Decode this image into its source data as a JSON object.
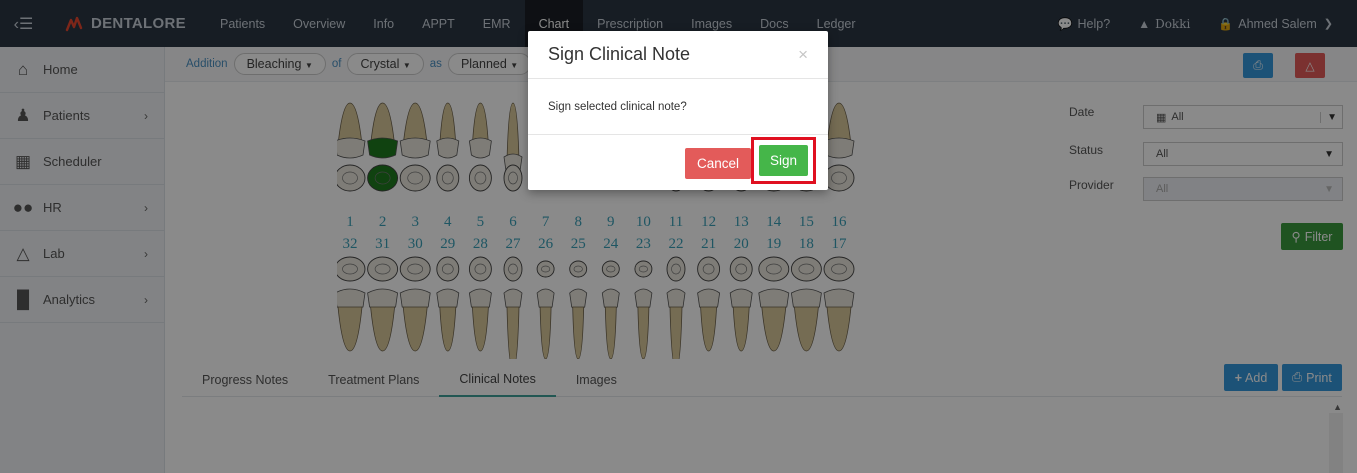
{
  "app": {
    "brand": "DENTALORE"
  },
  "nav": {
    "items": [
      {
        "label": "Patients"
      },
      {
        "label": "Overview"
      },
      {
        "label": "Info"
      },
      {
        "label": "APPT"
      },
      {
        "label": "EMR"
      },
      {
        "label": "Chart",
        "active": true
      },
      {
        "label": "Prescription"
      },
      {
        "label": "Images"
      },
      {
        "label": "Docs"
      },
      {
        "label": "Ledger"
      }
    ],
    "help": "Help?",
    "clinic": "Dokki",
    "user": "Ahmed Salem"
  },
  "sidebar": {
    "items": [
      {
        "label": "Home",
        "icon": "home-icon"
      },
      {
        "label": "Patients",
        "icon": "person-icon",
        "has_children": true
      },
      {
        "label": "Scheduler",
        "icon": "calendar-icon"
      },
      {
        "label": "HR",
        "icon": "users-icon",
        "has_children": true
      },
      {
        "label": "Lab",
        "icon": "flask-icon",
        "has_children": true
      },
      {
        "label": "Analytics",
        "icon": "bar-chart-icon",
        "has_children": true
      }
    ]
  },
  "toolbar": {
    "word1": "Addition",
    "procedure": "Bleaching",
    "word2": "of",
    "material": "Crystal",
    "word3": "as",
    "status": "Planned"
  },
  "teeth": {
    "upper_numbers": [
      "1",
      "2",
      "3",
      "4",
      "5",
      "6",
      "7",
      "8",
      "9",
      "10",
      "11",
      "12",
      "13",
      "14",
      "15",
      "16"
    ],
    "lower_numbers": [
      "32",
      "31",
      "30",
      "29",
      "28",
      "27",
      "26",
      "25",
      "24",
      "23",
      "22",
      "21",
      "20",
      "19",
      "18",
      "17"
    ],
    "highlighted_tooth": "2",
    "highlight_color": "#1f7a1f"
  },
  "filters": {
    "date_label": "Date",
    "date_value": "All",
    "status_label": "Status",
    "status_value": "All",
    "provider_label": "Provider",
    "provider_value": "All",
    "filter_button": "Filter"
  },
  "tabs": {
    "items": [
      {
        "label": "Progress Notes"
      },
      {
        "label": "Treatment Plans"
      },
      {
        "label": "Clinical Notes",
        "active": true
      },
      {
        "label": "Images"
      }
    ],
    "add_button": "Add",
    "print_button": "Print"
  },
  "modal": {
    "title": "Sign Clinical Note",
    "close": "×",
    "body": "Sign selected clinical note?",
    "cancel": "Cancel",
    "sign": "Sign"
  },
  "colors": {
    "topbar": "#2b3643",
    "accent_blue": "#3598dc",
    "danger": "#e35b5a",
    "success": "#45b649",
    "highlight_box": "#e01020"
  }
}
